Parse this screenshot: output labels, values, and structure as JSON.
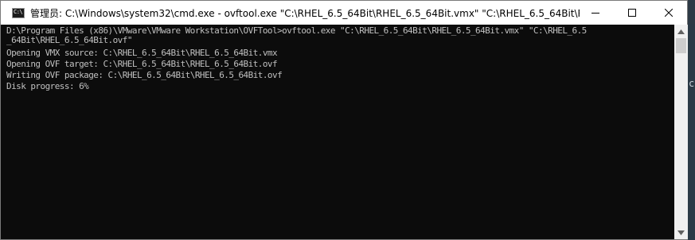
{
  "window": {
    "title": "管理员: C:\\Windows\\system32\\cmd.exe - ovftool.exe  \"C:\\RHEL_6.5_64Bit\\RHEL_6.5_64Bit.vmx\" \"C:\\RHEL_6.5_64Bit\\RHE...",
    "app_icon_text": "C:\\",
    "icons": {
      "app": "cmd-icon",
      "minimize": "minimize-icon",
      "maximize": "maximize-icon",
      "close": "close-icon"
    }
  },
  "console": {
    "lines": [
      "D:\\Program Files (x86)\\VMware\\VMware Workstation\\OVFTool>ovftool.exe \"C:\\RHEL_6.5_64Bit\\RHEL_6.5_64Bit.vmx\" \"C:\\RHEL_6.5",
      "_64Bit\\RHEL_6.5_64Bit.ovf\"",
      "Opening VMX source: C:\\RHEL_6.5_64Bit\\RHEL_6.5_64Bit.vmx",
      "Opening OVF target: C:\\RHEL_6.5_64Bit\\RHEL_6.5_64Bit.ovf",
      "Writing OVF package: C:\\RHEL_6.5_64Bit\\RHEL_6.5_64Bit.ovf",
      "Disk progress: 6%"
    ]
  },
  "colors": {
    "console_bg": "#0c0c0c",
    "console_text": "#c0c0c0",
    "titlebar_bg": "#ffffff"
  }
}
